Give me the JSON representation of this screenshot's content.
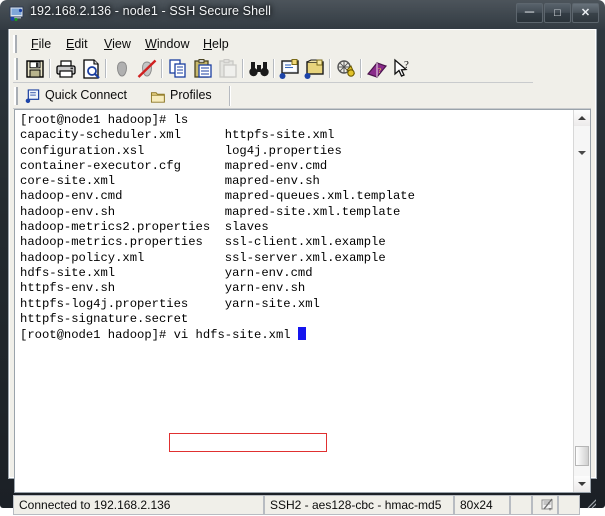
{
  "window": {
    "title": "192.168.2.136 - node1 - SSH Secure Shell",
    "icon": "ssh-app-icon",
    "controls": {
      "minimize": "—",
      "maximize": "❐",
      "close": "✕"
    }
  },
  "menubar": {
    "items": [
      {
        "label": "File",
        "pre": "",
        "key": "F",
        "post": "ile"
      },
      {
        "label": "Edit",
        "pre": "",
        "key": "E",
        "post": "dit"
      },
      {
        "label": "View",
        "pre": "",
        "key": "V",
        "post": "iew"
      },
      {
        "label": "Window",
        "pre": "",
        "key": "W",
        "post": "indow"
      },
      {
        "label": "Help",
        "pre": "",
        "key": "H",
        "post": "elp"
      }
    ]
  },
  "toolbar": {
    "buttons": [
      {
        "name": "save-icon",
        "tip": "Save"
      },
      {
        "name": "print-icon",
        "tip": "Print"
      },
      {
        "name": "print-preview-icon",
        "tip": "Print Preview"
      },
      {
        "name": "connect-icon",
        "tip": "Connect"
      },
      {
        "name": "disconnect-icon",
        "tip": "Disconnect"
      },
      {
        "name": "copy-icon",
        "tip": "Copy"
      },
      {
        "name": "paste-icon",
        "tip": "Paste"
      },
      {
        "name": "paste-disabled-icon",
        "tip": "Paste (disabled)"
      },
      {
        "name": "find-icon",
        "tip": "Find"
      },
      {
        "name": "new-terminal-icon",
        "tip": "New Terminal"
      },
      {
        "name": "new-file-transfer-icon",
        "tip": "New File Transfer"
      },
      {
        "name": "settings-icon",
        "tip": "Settings"
      },
      {
        "name": "help-book-icon",
        "tip": "Help"
      },
      {
        "name": "context-help-icon",
        "tip": "Context Help"
      }
    ]
  },
  "quickbar": {
    "quick_connect": "Quick Connect",
    "profiles": "Profiles",
    "quick_connect_icon": "quick-connect-icon",
    "profiles_icon": "profiles-folder-icon"
  },
  "terminal": {
    "prompt": "[root@node1 hadoop]# ",
    "first_command": "ls",
    "columns": [
      [
        "capacity-scheduler.xml",
        "configuration.xsl",
        "container-executor.cfg",
        "core-site.xml",
        "hadoop-env.cmd",
        "hadoop-env.sh",
        "hadoop-metrics2.properties",
        "hadoop-metrics.properties",
        "hadoop-policy.xml",
        "hdfs-site.xml",
        "httpfs-env.sh",
        "httpfs-log4j.properties",
        "httpfs-signature.secret"
      ],
      [
        "httpfs-site.xml",
        "log4j.properties",
        "mapred-env.cmd",
        "mapred-env.sh",
        "mapred-queues.xml.template",
        "mapred-site.xml.template",
        "slaves",
        "ssl-client.xml.example",
        "ssl-server.xml.example",
        "yarn-env.cmd",
        "yarn-env.sh",
        "yarn-site.xml",
        ""
      ]
    ],
    "current_command": "vi hdfs-site.xml ",
    "cursor": "block-cursor",
    "highlight_color": "#e03030",
    "cursor_color": "#1515ee",
    "background": "#ffffff",
    "foreground": "#000000"
  },
  "scrollbar": {
    "up_arrow": "scroll-up-arrow",
    "down_arrow": "scroll-down-arrow",
    "thumb": "scroll-thumb"
  },
  "statusbar": {
    "connection": "Connected to 192.168.2.136",
    "cipher": "SSH2 - aes128-cbc - hmac-md5",
    "size": "80x24",
    "cell4": "",
    "cell5_icon": "encrypt-indicator-icon",
    "cell6": "",
    "resize_grip": "resize-grip"
  }
}
